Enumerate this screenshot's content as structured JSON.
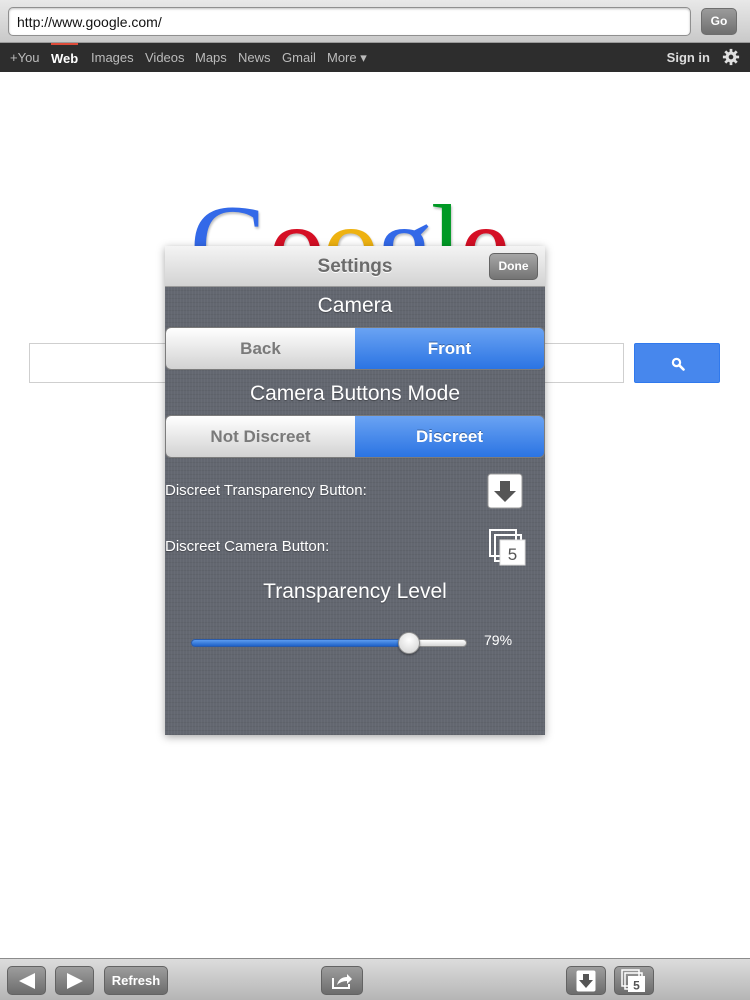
{
  "browser": {
    "url": "http://www.google.com/",
    "go_label": "Go"
  },
  "google_nav": {
    "items": [
      "+You",
      "Web",
      "Images",
      "Videos",
      "Maps",
      "News",
      "Gmail",
      "More ▾"
    ],
    "active": "Web",
    "sign_in": "Sign in",
    "icons": [
      "gear-icon"
    ]
  },
  "google_page": {
    "logo_letters": [
      "G",
      "o",
      "o",
      "g",
      "l",
      "e"
    ],
    "logo_colors": [
      "#3369e8",
      "#d50f25",
      "#eeb211",
      "#3369e8",
      "#009925",
      "#d50f25"
    ],
    "search_value": "",
    "search_icon": "magnifier-icon"
  },
  "settings": {
    "title": "Settings",
    "done_label": "Done",
    "camera": {
      "label": "Camera",
      "options": [
        "Back",
        "Front"
      ],
      "selected": "Front"
    },
    "buttons_mode": {
      "label": "Camera Buttons Mode",
      "options": [
        "Not Discreet",
        "Discreet"
      ],
      "selected": "Discreet"
    },
    "transparency_button_label": "Discreet Transparency Button:",
    "transparency_button_icon": "down-arrow-icon",
    "camera_button_label": "Discreet Camera Button:",
    "camera_button_icon": "stacked-5-icon",
    "camera_button_digit": "5",
    "transparency_level": {
      "label": "Transparency Level",
      "value_percent": 79,
      "display": "79%"
    }
  },
  "toolbar": {
    "back_icon": "back-arrow-icon",
    "forward_icon": "forward-arrow-icon",
    "refresh_label": "Refresh",
    "share_icon": "share-icon",
    "transparency_icon": "down-arrow-icon",
    "camera_icon": "stacked-5-icon",
    "camera_digit": "5"
  },
  "colors": {
    "accent_blue": "#2b74e3",
    "search_blue": "#4787ed",
    "gbar_bg": "#2d2d2d"
  }
}
